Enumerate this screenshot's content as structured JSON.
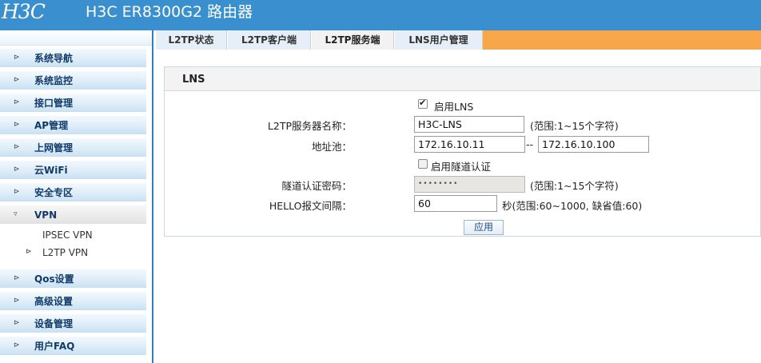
{
  "header": {
    "logo": "H3C",
    "title": "H3C ER8300G2 路由器"
  },
  "sidebar": {
    "items": [
      {
        "label": "系统导航"
      },
      {
        "label": "系统监控"
      },
      {
        "label": "接口管理"
      },
      {
        "label": "AP管理"
      },
      {
        "label": "上网管理"
      },
      {
        "label": "云WiFi"
      },
      {
        "label": "安全专区"
      },
      {
        "label": "VPN"
      },
      {
        "label": "Qos设置"
      },
      {
        "label": "高级设置"
      },
      {
        "label": "设备管理"
      },
      {
        "label": "用户FAQ"
      }
    ],
    "vpn_sub": [
      {
        "label": "IPSEC VPN"
      },
      {
        "label": "L2TP VPN"
      }
    ]
  },
  "tabs": [
    {
      "label": "L2TP状态"
    },
    {
      "label": "L2TP客户端"
    },
    {
      "label": "L2TP服务端"
    },
    {
      "label": "LNS用户管理"
    }
  ],
  "panel": {
    "title": "LNS",
    "enable_lns_label": "启用LNS",
    "server_name_label": "L2TP服务器名称：",
    "server_name_value": "H3C-LNS",
    "server_name_hint": "(范围:1~15个字符)",
    "pool_label": "地址池：",
    "pool_start": "172.16.10.11",
    "pool_sep": "--",
    "pool_end": "172.16.10.100",
    "tunnel_auth_label": "启用隧道认证",
    "tunnel_pwd_label": "隧道认证密码：",
    "tunnel_pwd_value": "••••••••",
    "tunnel_pwd_hint": "(范围:1~15个字符)",
    "hello_label": "HELLO报文间隔：",
    "hello_value": "60",
    "hello_hint": "秒(范围:60~1000, 缺省值:60)",
    "apply_label": "应用"
  },
  "colors": {
    "header_bg": "#3a8fcf",
    "tabbar_bg": "#f7a64a",
    "sidebar_border": "#2e7fc0"
  }
}
